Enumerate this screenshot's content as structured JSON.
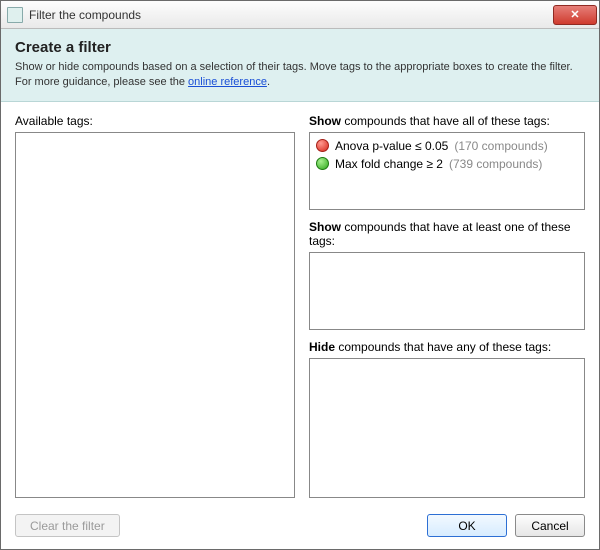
{
  "window": {
    "title": "Filter the compounds"
  },
  "header": {
    "heading": "Create a filter",
    "desc_pre": "Show or hide compounds based on a selection of their tags. Move tags to the appropriate boxes to create the filter. For more guidance, please see the ",
    "link_text": "online reference",
    "desc_post": "."
  },
  "labels": {
    "available": "Available tags:",
    "show_all_pre": "Show",
    "show_all_post": " compounds that have all of these tags:",
    "show_any_pre": "Show",
    "show_any_post": " compounds that have at least one of these tags:",
    "hide_pre": "Hide",
    "hide_post": " compounds that have any of these tags:"
  },
  "show_all_tags": [
    {
      "color": "red",
      "name": "Anova p-value ≤ 0.05",
      "count": "(170 compounds)"
    },
    {
      "color": "green",
      "name": "Max fold change ≥ 2",
      "count": "(739 compounds)"
    }
  ],
  "buttons": {
    "clear": "Clear the filter",
    "ok": "OK",
    "cancel": "Cancel"
  }
}
